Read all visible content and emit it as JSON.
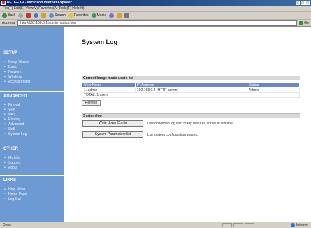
{
  "window": {
    "title": "NETGEAR - Microsoft Internet Explorer"
  },
  "menu": {
    "items_text": "File(F) Edit(E) View(V) Favorites(A) Tools(T) Help(H)"
  },
  "toolbar": {
    "back": "Back",
    "search": "Search",
    "favorites": "Favorites",
    "media": "Media"
  },
  "address": {
    "label": "Address",
    "value": "http://192.168.0.1/admin_status.htm",
    "go": "Go"
  },
  "sidebar": {
    "sections": [
      {
        "title": "SETUP",
        "items": [
          "Setup Wizard",
          "Basic",
          "Network",
          "Wireless",
          "Access Points"
        ]
      },
      {
        "title": "ADVANCED",
        "items": [
          "Firewall",
          "VPN",
          "NAT",
          "Routing",
          "Advanced",
          "QoS",
          "System Log"
        ]
      },
      {
        "title": "OTHER",
        "items": [
          "My Info",
          "Support",
          "About"
        ]
      },
      {
        "title": "LINKS",
        "items": [
          "Help Menu",
          "Home Page",
          "Log Out"
        ]
      }
    ]
  },
  "main": {
    "title": "System Log",
    "current_users": {
      "heading": "Current Image mode users list",
      "columns": [
        "User Name",
        "IP Address",
        "Status"
      ],
      "rows": [
        [
          "1. admin",
          "192.168.0.2 (HTTP admin)",
          "Admin"
        ]
      ],
      "total": "TOTAL: 1 users",
      "refresh_label": "Refresh"
    },
    "system_log": {
      "heading": "System log",
      "buttons": [
        {
          "label": "Write down Config",
          "description": "Use download log with many features above at runtime."
        },
        {
          "label": "System Parameters list",
          "description": "List system configuration values."
        }
      ]
    }
  },
  "status": {
    "text": "Done",
    "zone": "Internet"
  }
}
